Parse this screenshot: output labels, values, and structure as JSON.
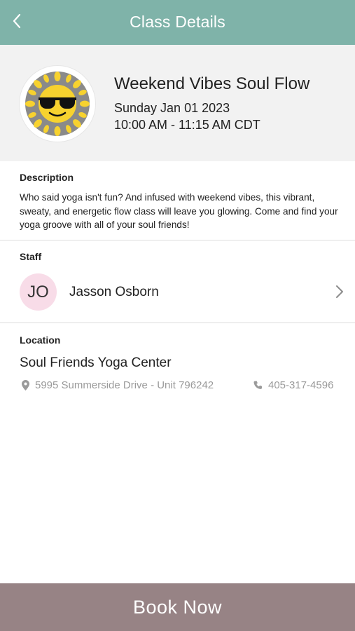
{
  "header": {
    "title": "Class Details",
    "back_icon": "chevron-left-icon",
    "background_color": "#7fb3a9"
  },
  "class_info": {
    "image_icon": "sun-with-sunglasses-icon",
    "name": "Weekend Vibes Soul Flow",
    "date": "Sunday Jan 01 2023",
    "time": "10:00 AM - 11:15 AM CDT"
  },
  "description": {
    "label": "Description",
    "text": "Who said yoga isn't fun?  And infused with weekend vibes, this vibrant, sweaty, and energetic flow class will leave you glowing. Come and find your yoga groove with all of your soul friends!"
  },
  "staff": {
    "label": "Staff",
    "initials": "JO",
    "name": "Jasson Osborn",
    "avatar_color": "#f8dce8",
    "chevron_icon": "chevron-right-icon"
  },
  "location": {
    "label": "Location",
    "name": "Soul Friends Yoga Center",
    "address_icon": "map-pin-icon",
    "address": "5995 Summerside Drive - Unit 796242",
    "phone_icon": "phone-icon",
    "phone": "405-317-4596"
  },
  "footer": {
    "book_label": "Book Now",
    "button_color": "#978385"
  }
}
